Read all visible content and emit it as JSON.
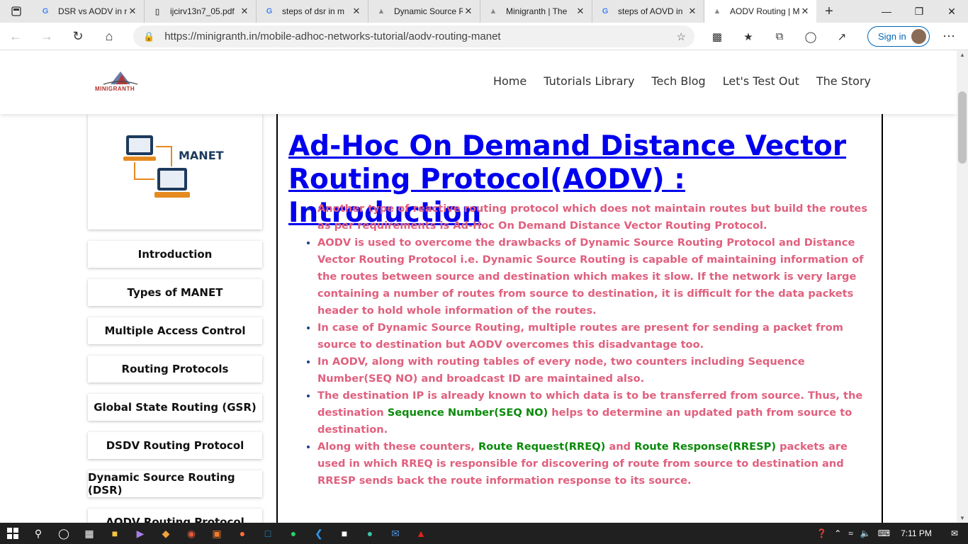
{
  "browser": {
    "tabs": [
      {
        "title": "DSR vs AODV in r",
        "icon": "google-icon",
        "active": false
      },
      {
        "title": "ijcirv13n7_05.pdf",
        "icon": "pdf-icon",
        "active": false
      },
      {
        "title": "steps of dsr in m",
        "icon": "google-icon",
        "active": false
      },
      {
        "title": "Dynamic Source R",
        "icon": "minigranth-icon",
        "active": false
      },
      {
        "title": "Minigranth | The",
        "icon": "minigranth-icon",
        "active": false
      },
      {
        "title": "steps of AOVD in",
        "icon": "google-icon",
        "active": false
      },
      {
        "title": "AODV Routing | M",
        "icon": "minigranth-icon",
        "active": true
      }
    ],
    "url": "https://minigranth.in/mobile-adhoc-networks-tutorial/aodv-routing-manet",
    "sign_in": "Sign in"
  },
  "site": {
    "logo_text": "MINIGRANTH",
    "nav": [
      "Home",
      "Tutorials Library",
      "Tech Blog",
      "Let's Test Out",
      "The Story"
    ],
    "sidebar_image_label": "MANET",
    "sidebar": [
      "Introduction",
      "Types of MANET",
      "Multiple Access Control",
      "Routing Protocols",
      "Global State Routing (GSR)",
      "DSDV Routing Protocol",
      "Dynamic Source Routing (DSR)",
      "AODV Routing Protocol"
    ]
  },
  "article": {
    "title": "Ad-Hoc On Demand Distance Vector Routing Protocol(AODV) : Introduction",
    "bullets": [
      {
        "parts": [
          {
            "t": "Another type of reactive routing protocol which does not maintain routes but build the routes as per requirements is Ad-Hoc On Demand Distance Vector Routing Protocol."
          }
        ]
      },
      {
        "parts": [
          {
            "t": "AODV is used to overcome the drawbacks of Dynamic Source Routing Protocol and Distance Vector Routing Protocol i.e. Dynamic Source Routing is capable of maintaining information of the routes between source and destination which makes it slow. If the network is very large containing a number of routes from source to destination, it is difficult for the data packets header to hold whole information of the routes."
          }
        ]
      },
      {
        "parts": [
          {
            "t": "In case of Dynamic Source Routing, multiple routes are present for sending a packet from source to destination but AODV overcomes this disadvantage too."
          }
        ]
      },
      {
        "parts": [
          {
            "t": "In AODV, along with routing tables of every node, two counters including Sequence Number(SEQ NO) and broadcast ID are maintained also."
          }
        ]
      },
      {
        "parts": [
          {
            "t": "The destination IP is already known to which data is to be transferred from source. Thus, the destination "
          },
          {
            "t": "Sequence Number(SEQ NO)",
            "g": true
          },
          {
            "t": " helps to determine an updated path from source to destination."
          }
        ]
      },
      {
        "parts": [
          {
            "t": "Along with these counters, "
          },
          {
            "t": "Route Request(RREQ)",
            "g": true
          },
          {
            "t": " and "
          },
          {
            "t": "Route Response(RRESP)",
            "g": true
          },
          {
            "t": " packets are used in which RREQ is responsible for discovering of route from source to destination and RRESP sends back the route information response to its source."
          }
        ]
      }
    ]
  },
  "taskbar": {
    "clock": "7:11 PM"
  },
  "colors": {
    "title_link": "#0000ee",
    "bullet_text": "#e0607e",
    "highlight": "#0a8a0a"
  }
}
